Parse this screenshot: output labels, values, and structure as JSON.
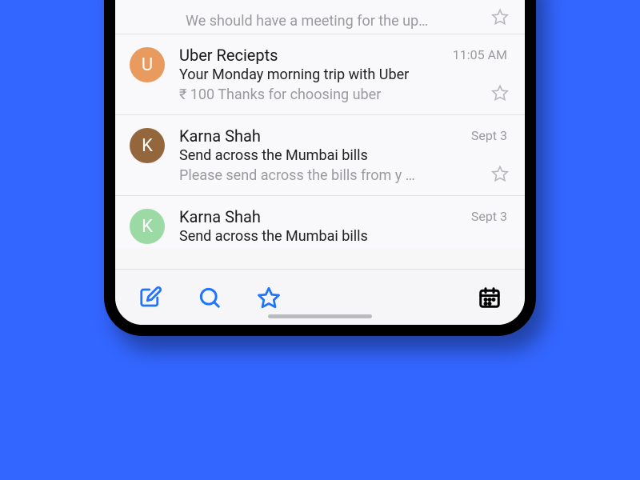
{
  "partial": {
    "preview": "We should have a meeting for the up…"
  },
  "emails": [
    {
      "avatar_letter": "U",
      "avatar_color": "#e89a5f",
      "sender": "Uber Reciepts",
      "date": "11:05 AM",
      "subject": "Your Monday morning trip with Uber",
      "preview": "₹ 100 Thanks for choosing uber"
    },
    {
      "avatar_letter": "K",
      "avatar_color": "#93663b",
      "sender": "Karna Shah",
      "date": "Sept 3",
      "subject": "Send across the Mumbai bills",
      "preview": "Please send across the bills from y …"
    },
    {
      "avatar_letter": "K",
      "avatar_color": "#9bd9a5",
      "sender": "Karna Shah",
      "date": "Sept 3",
      "subject": "Send across the Mumbai bills",
      "preview": ""
    }
  ],
  "colors": {
    "accent": "#1f74ff",
    "bg": "#3366ff"
  }
}
